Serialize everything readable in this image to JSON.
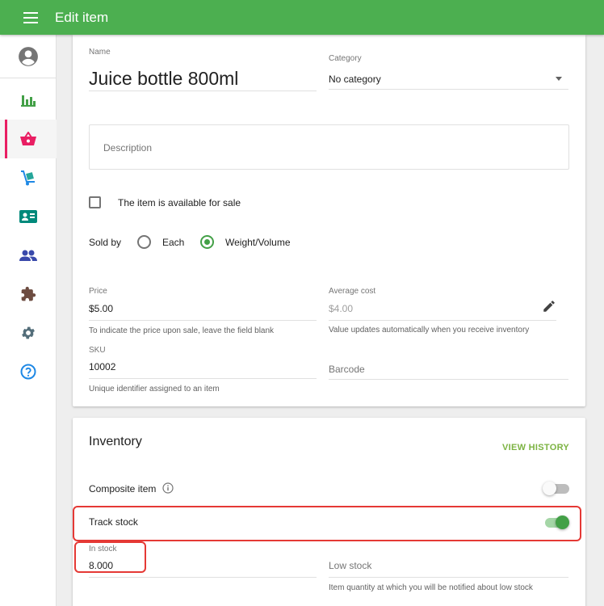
{
  "appbar": {
    "title": "Edit item",
    "menu_icon": "menu-icon",
    "color": "#4caf50"
  },
  "sidebar": {
    "active_color": "#e91e63",
    "items": [
      {
        "name": "account",
        "icon": "account-circle-icon"
      },
      {
        "name": "reports",
        "icon": "bar-chart-icon"
      },
      {
        "name": "items",
        "icon": "basket-icon",
        "active": true
      },
      {
        "name": "inventory",
        "icon": "cart-dolly-icon"
      },
      {
        "name": "employees",
        "icon": "id-card-icon"
      },
      {
        "name": "customers",
        "icon": "people-icon"
      },
      {
        "name": "integrations",
        "icon": "puzzle-icon"
      },
      {
        "name": "settings",
        "icon": "gear-icon"
      },
      {
        "name": "help",
        "icon": "help-icon"
      }
    ]
  },
  "item": {
    "name_label": "Name",
    "name_value": "Juice bottle 800ml",
    "category_label": "Category",
    "category_value": "No category",
    "description_placeholder": "Description",
    "available_label": "The item is available for sale",
    "available_checked": false,
    "sold_by_label": "Sold by",
    "sold_by_options": [
      "Each",
      "Weight/Volume"
    ],
    "sold_by_selected": "Weight/Volume",
    "price_label": "Price",
    "price_value": "$5.00",
    "price_hint": "To indicate the price upon sale, leave the field blank",
    "avg_cost_label": "Average cost",
    "avg_cost_value": "$4.00",
    "avg_cost_hint": "Value updates automatically when you receive inventory",
    "sku_label": "SKU",
    "sku_value": "10002",
    "sku_hint": "Unique identifier assigned to an item",
    "barcode_placeholder": "Barcode"
  },
  "inventory": {
    "title": "Inventory",
    "view_history": "VIEW HISTORY",
    "composite_label": "Composite item",
    "composite_on": false,
    "track_stock_label": "Track stock",
    "track_stock_on": true,
    "in_stock_label": "In stock",
    "in_stock_value": "8.000",
    "low_stock_placeholder": "Low stock",
    "low_stock_hint": "Item quantity at which you will be notified about low stock"
  },
  "colors": {
    "accent": "#43a047",
    "highlight": "#e53935",
    "link": "#7cb342"
  }
}
